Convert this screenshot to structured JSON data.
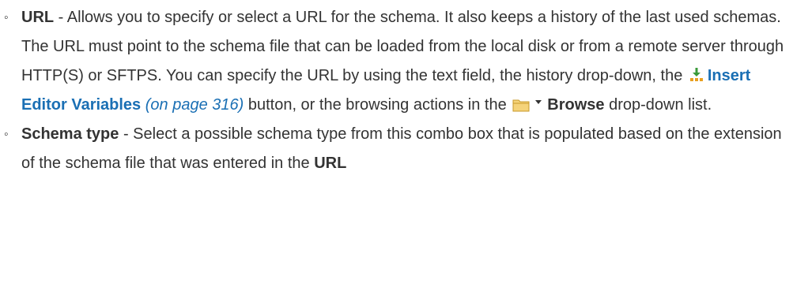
{
  "items": [
    {
      "bullet": "◦",
      "term": "URL",
      "sep": " - ",
      "text1": "Allows you to specify or select a URL for the schema. It also keeps a history of the last used schemas. The URL must point to the schema file that can be loaded from the local disk or from a remote server through HTTP(S) or SFTPS. You can specify the URL by using the text field, the history drop-down, the ",
      "insert_icon": "insert-editor-variables-icon",
      "link_label": "Insert Editor Variables",
      "page_ref": "(on page 316)",
      "text2": " button, or the browsing actions in the ",
      "folder_icon": "folder-icon",
      "dropdown_icon": "dropdown-arrow-icon",
      "browse_label": "Browse",
      "text3": " drop-down list."
    },
    {
      "bullet": "◦",
      "term": "Schema type",
      "sep": " - ",
      "text1": "Select a possible schema type from this combo box that is populated based on the extension of the schema file that was entered in the ",
      "term2": "URL"
    }
  ],
  "colors": {
    "link": "#1a6fb4",
    "text": "#333333",
    "folder_fill": "#f5d37a",
    "insert_icon_green": "#3a9a3a",
    "insert_icon_orange": "#e8a020"
  }
}
